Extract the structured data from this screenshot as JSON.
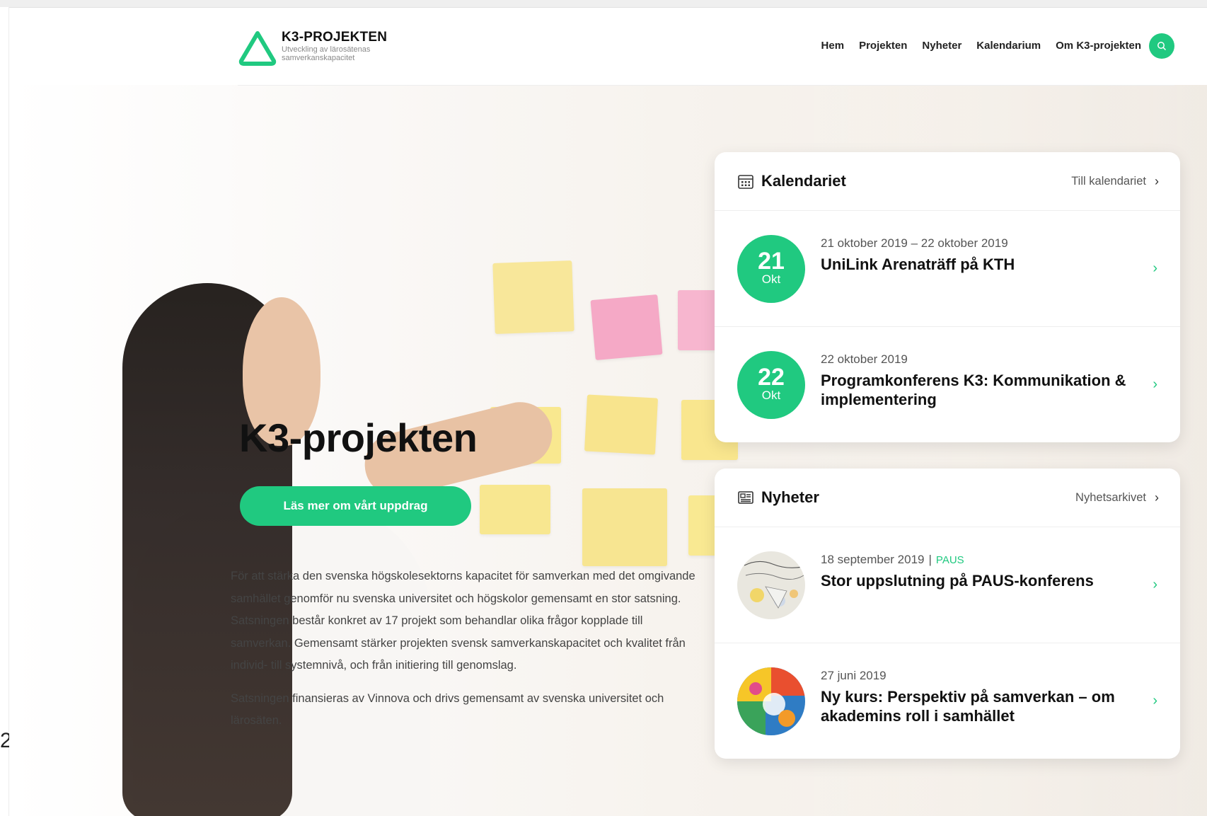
{
  "header": {
    "logo_title": "K3-PROJEKTEN",
    "logo_subtitle": "Utveckling av lärosätenas samverkanskapacitet",
    "nav": [
      "Hem",
      "Projekten",
      "Nyheter",
      "Kalendarium",
      "Om K3-projekten"
    ],
    "search_icon": "search-icon"
  },
  "hero": {
    "title": "K3-projekten",
    "cta_label": "Läs mer om vårt uppdrag",
    "paragraphs": [
      "För att stärka den svenska högskolesektorns kapacitet för samverkan med det omgivande samhället genomför nu svenska universitet och högskolor gemensamt en stor satsning. Satsningen består konkret av 17 projekt som behandlar olika frågor kopplade till samverkan. Gemensamt stärker projekten svensk samverkanskapacitet och kvalitet från individ- till systemnivå, och från initiering till genomslag.",
      "Satsningen finansieras av Vinnova och drivs gemensamt av svenska universitet och lärosäten."
    ]
  },
  "calendar": {
    "title": "Kalendariet",
    "link_label": "Till kalendariet",
    "icon": "calendar-icon",
    "events": [
      {
        "day": "21",
        "month": "Okt",
        "date": "21 oktober 2019 – 22 oktober 2019",
        "title": "UniLink Arenaträff på KTH"
      },
      {
        "day": "22",
        "month": "Okt",
        "date": "22 oktober 2019",
        "title": "Programkonferens K3: Kommunikation & implementering"
      }
    ]
  },
  "news": {
    "title": "Nyheter",
    "link_label": "Nyhetsarkivet",
    "icon": "newspaper-icon",
    "items": [
      {
        "date": "18 september 2019",
        "separator": "|",
        "tag": "PAUS",
        "title": "Stor uppslutning på PAUS-konferens"
      },
      {
        "date": "27 juni 2019",
        "title": "Ny kurs: Perspektiv på samverkan – om akademins roll i samhället"
      }
    ]
  },
  "colors": {
    "accent": "#20c980",
    "text": "#111111",
    "muted": "#555555"
  },
  "page_margin_char": "2"
}
